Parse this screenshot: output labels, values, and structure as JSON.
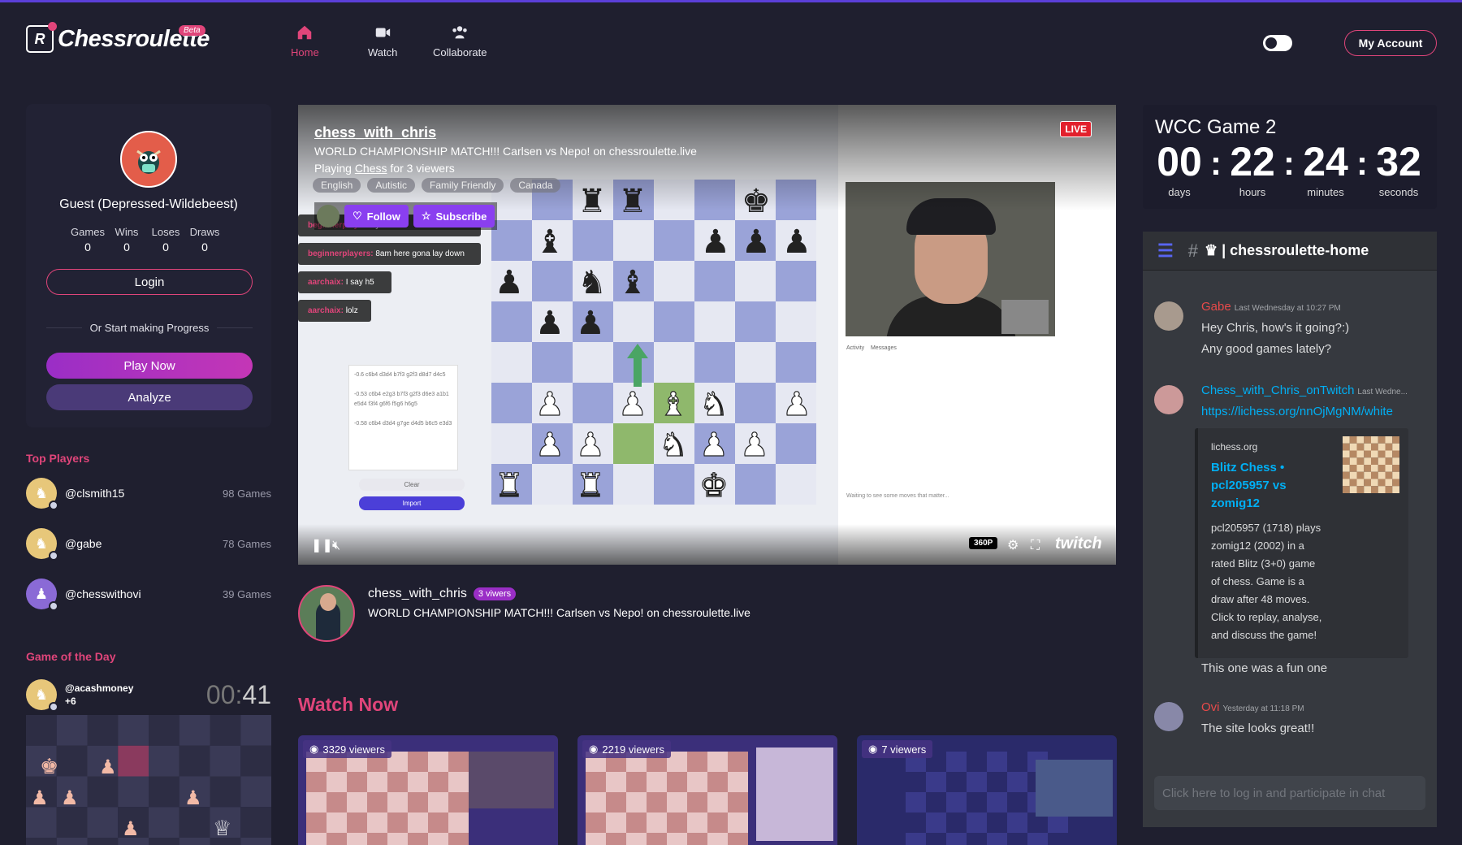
{
  "header": {
    "logo_text": "Chessroulette",
    "beta_badge": "Beta",
    "nav": [
      {
        "label": "Home",
        "icon": "home-icon",
        "active": true
      },
      {
        "label": "Watch",
        "icon": "video-camera-icon",
        "active": false
      },
      {
        "label": "Collaborate",
        "icon": "people-icon",
        "active": false
      }
    ],
    "account_button": "My Account"
  },
  "profile": {
    "name": "Guest (Depressed-Wildebeest)",
    "stats": [
      {
        "label": "Games",
        "value": "0"
      },
      {
        "label": "Wins",
        "value": "0"
      },
      {
        "label": "Loses",
        "value": "0"
      },
      {
        "label": "Draws",
        "value": "0"
      }
    ],
    "login_label": "Login",
    "divider_text": "Or Start making Progress",
    "play_label": "Play Now",
    "analyze_label": "Analyze"
  },
  "top_players": {
    "title": "Top Players",
    "players": [
      {
        "name": "@clsmith15",
        "games": "98 Games"
      },
      {
        "name": "@gabe",
        "games": "78 Games"
      },
      {
        "name": "@chesswithovi",
        "games": "39 Games"
      }
    ]
  },
  "game_of_day": {
    "title": "Game of the Day",
    "player": "@acashmoney",
    "extra": "+6",
    "timer_min": "00",
    "timer_sep": ":",
    "timer_sec": "41"
  },
  "video": {
    "channel": "chess_with_chris",
    "title": "WORLD CHAMPIONSHIP MATCH!!! Carlsen vs Nepo! on chessroulette.live",
    "playing_prefix": "Playing ",
    "playing_game": "Chess",
    "playing_suffix": " for 3 viewers",
    "tags": [
      "English",
      "Autistic",
      "Family Friendly",
      "Canada"
    ],
    "follow_label": "Follow",
    "subscribe_label": "Subscribe",
    "live_badge": "LIVE",
    "resolution": "360P",
    "brand": "twitch",
    "chat_messages": [
      {
        "user": "beginnerplayers:",
        "text": "yeah"
      },
      {
        "user": "beginnerplayers:",
        "text": "8am here gona lay down"
      },
      {
        "user": "aarchaix:",
        "text": "I say h5"
      },
      {
        "user": "aarchaix:",
        "text": "lolz"
      }
    ],
    "analysis_lines": [
      "-0.6 c6b4 d3d4 b7f3 g2f3 d8d7 d4c5",
      "-0.53 c6b4 e2g3 b7f3 g2f3 d6e3 a1b1 e5d4 f3f4 g6f6 f5g6 h6g5",
      "-0.58 c6b4 d3d4 g7ge d4d5 b6c5 e3d3"
    ],
    "clear_label": "Clear",
    "import_label": "Import",
    "activity_label": "Activity",
    "messages_label": "Messages",
    "waiting_text": "Waiting to see some moves that matter..."
  },
  "streamer": {
    "name": "chess_with_chris",
    "viewers": "3 viwers",
    "title": "WORLD CHAMPIONSHIP MATCH!!! Carlsen vs Nepo! on chessroulette.live"
  },
  "watch_now": {
    "title": "Watch Now",
    "streams": [
      {
        "viewers": "3329 viewers"
      },
      {
        "viewers": "2219 viewers"
      },
      {
        "viewers": "7 viewers"
      }
    ]
  },
  "countdown": {
    "title": "WCC Game 2",
    "units": [
      {
        "value": "00",
        "label": "days"
      },
      {
        "value": "22",
        "label": "hours"
      },
      {
        "value": "24",
        "label": "minutes"
      },
      {
        "value": "32",
        "label": "seconds"
      }
    ]
  },
  "chat": {
    "channel": "| chessroulette-home",
    "messages": [
      {
        "user": "Gabe",
        "color": "#e84a4a",
        "time": "Last Wednesday at 10:27 PM",
        "lines": [
          "Hey Chris, how's it going?:)",
          "Any good games lately?"
        ]
      },
      {
        "user": "Chess_with_Chris_onTwitch",
        "color": "#00aff4",
        "time": "Last Wedne...",
        "link": "https://lichess.org/nnOjMgNM/white",
        "after": "This one was a fun one"
      },
      {
        "user": "Ovi",
        "color": "#e84a4a",
        "time": "Yesterday at 11:18 PM",
        "lines": [
          "The site looks great!!"
        ]
      }
    ],
    "embed": {
      "provider": "lichess.org",
      "title": "Blitz Chess • pcl205957 vs zomig12",
      "description": "pcl205957 (1718) plays zomig12 (2002) in a rated Blitz (3+0) game of chess. Game is a draw after 48 moves. Click to replay, analyse, and discuss the game!"
    },
    "input_placeholder": "Click here to log in and participate in chat"
  }
}
